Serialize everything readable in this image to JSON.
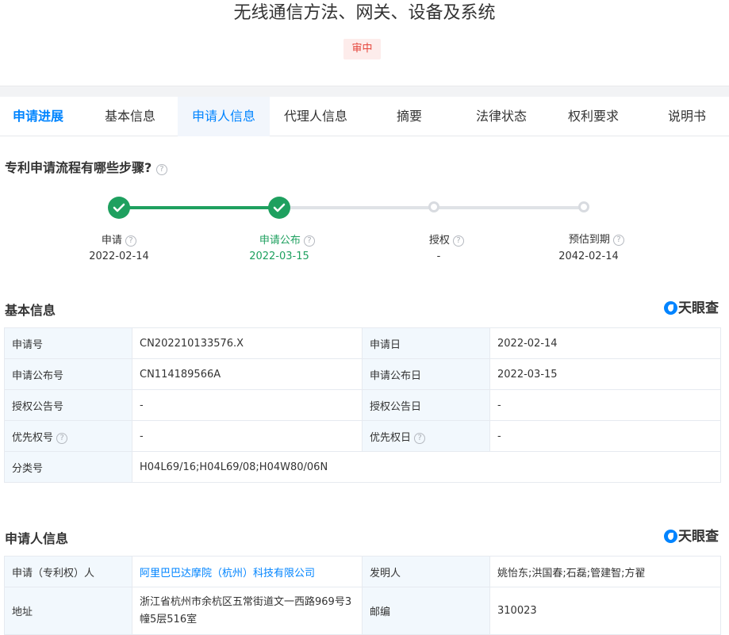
{
  "title": "无线通信方法、网关、设备及系统",
  "status": "审中",
  "tabs": [
    "申请进展",
    "基本信息",
    "申请人信息",
    "代理人信息",
    "摘要",
    "法律状态",
    "权利要求",
    "说明书"
  ],
  "process": {
    "heading": "专利申请流程有哪些步骤?",
    "steps": [
      {
        "label": "申请",
        "date": "2022-02-14",
        "done": true
      },
      {
        "label": "申请公布",
        "date": "2022-03-15",
        "done": true
      },
      {
        "label": "授权",
        "date": "-",
        "done": false
      },
      {
        "label": "预估到期",
        "date": "2042-02-14",
        "done": false
      }
    ]
  },
  "brand": "天眼查",
  "basic_info": {
    "heading": "基本信息",
    "app_no_label": "申请号",
    "app_no": "CN202210133576.X",
    "app_date_label": "申请日",
    "app_date": "2022-02-14",
    "pub_no_label": "申请公布号",
    "pub_no": "CN114189566A",
    "pub_date_label": "申请公布日",
    "pub_date": "2022-03-15",
    "grant_no_label": "授权公告号",
    "grant_no": "-",
    "grant_date_label": "授权公告日",
    "grant_date": "-",
    "priority_no_label": "优先权号",
    "priority_no": "-",
    "priority_date_label": "优先权日",
    "priority_date": "-",
    "class_label": "分类号",
    "class": "H04L69/16;H04L69/08;H04W80/06N"
  },
  "applicant_info": {
    "heading": "申请人信息",
    "applicant_label": "申请（专利权）人",
    "applicant": "阿里巴巴达摩院（杭州）科技有限公司",
    "inventor_label": "发明人",
    "inventors": "姚怡东;洪国春;石磊;管建智;方翟",
    "address_label": "地址",
    "address": "浙江省杭州市余杭区五常街道文一西路969号3幢5层516室",
    "postcode_label": "邮编",
    "postcode": "310023"
  },
  "colors": {
    "accent": "#0084ff",
    "done": "#1ea05f",
    "status": "#e5453b"
  }
}
